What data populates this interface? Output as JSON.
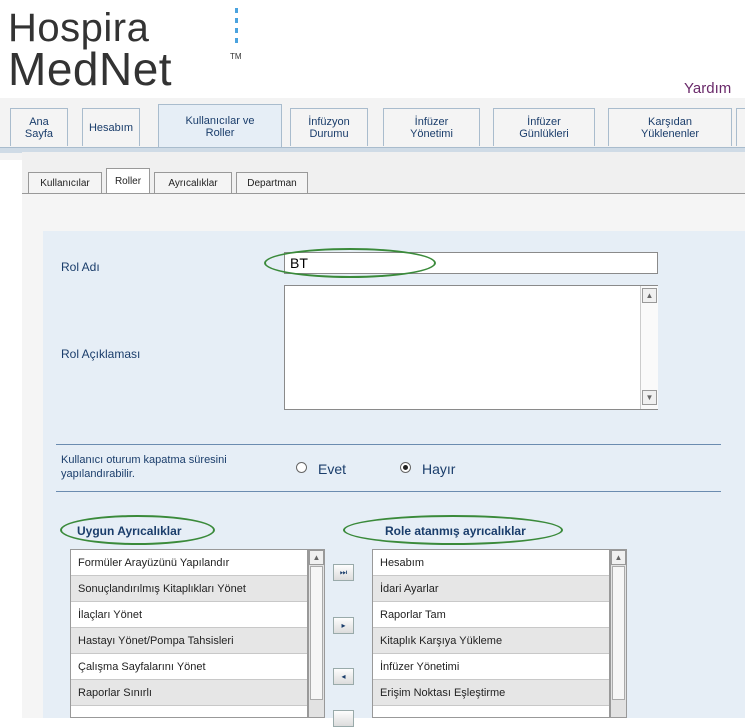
{
  "header": {
    "logo_line1": "Hospira",
    "logo_line2": "MedNet",
    "logo_tm": "TM",
    "help_label": "Yardım"
  },
  "main_tabs": [
    {
      "label": "Ana\nSayfa"
    },
    {
      "label": "Hesabım"
    },
    {
      "label": "Kullanıcılar ve\nRoller"
    },
    {
      "label": "İnfüzyon\nDurumu"
    },
    {
      "label": "İnfüzer\nYönetimi"
    },
    {
      "label": "İnfüzer\nGünlükleri"
    },
    {
      "label": "Karşıdan\nYüklenenler"
    }
  ],
  "sub_tabs": [
    {
      "label": "Kullanıcılar"
    },
    {
      "label": "Roller"
    },
    {
      "label": "Ayrıcalıklar"
    },
    {
      "label": "Departman"
    }
  ],
  "form": {
    "role_name_label": "Rol Adı",
    "role_name_value": "BT",
    "role_desc_label": "Rol Açıklaması",
    "role_desc_value": "",
    "timeout_label": "Kullanıcı oturum kapatma süresini yapılandırabilir.",
    "option_yes": "Evet",
    "option_no": "Hayır",
    "selected_option": "Hayır"
  },
  "available_privileges": {
    "header": "Uygun Ayrıcalıklar",
    "items": [
      "Formüler Arayüzünü Yapılandır",
      "Sonuçlandırılmış Kitaplıkları Yönet",
      "İlaçları Yönet",
      "Hastayı Yönet/Pompa Tahsisleri",
      "Çalışma Sayfalarını Yönet",
      "Raporlar Sınırlı"
    ]
  },
  "assigned_privileges": {
    "header": "Role atanmış ayrıcalıklar",
    "items": [
      "Hesabım",
      "İdari Ayarlar",
      "Raporlar Tam",
      "Kitaplık Karşıya Yükleme",
      "İnfüzer Yönetimi",
      "Erişim Noktası Eşleştirme"
    ]
  },
  "move_buttons": {
    "add_all": "⏭",
    "add_one": "▸",
    "remove_one": "◂"
  },
  "colors": {
    "accent_blue": "#1a3d6b",
    "highlight_green": "#3a8a3a",
    "panel_blue": "#e6eef6"
  }
}
